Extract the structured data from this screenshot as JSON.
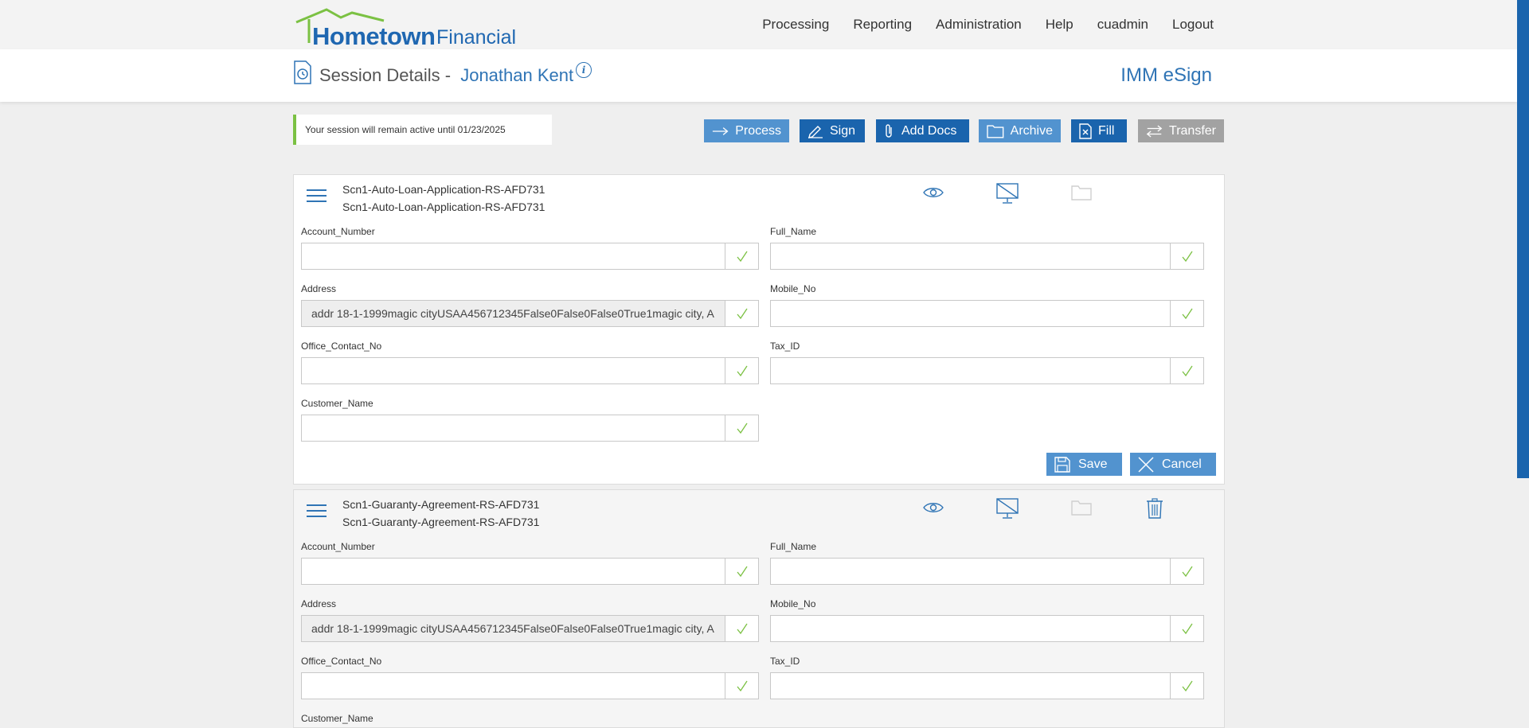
{
  "brand": {
    "name_primary": "Hometown",
    "name_secondary": "Financial"
  },
  "nav": {
    "items": [
      "Processing",
      "Reporting",
      "Administration",
      "Help",
      "cuadmin",
      "Logout"
    ]
  },
  "session": {
    "title": "Session Details -",
    "customer": "Jonathan Kent",
    "product": "IMM eSign"
  },
  "notice": "Your session will remain active until 01/23/2025",
  "actions": {
    "process": "Process",
    "sign": "Sign",
    "add_docs": "Add Docs",
    "archive": "Archive",
    "fill": "Fill",
    "transfer": "Transfer"
  },
  "documents": [
    {
      "title_line1": "Scn1-Auto-Loan-Application-RS-AFD731",
      "title_line2": "Scn1-Auto-Loan-Application-RS-AFD731",
      "fields": {
        "account_number": {
          "label": "Account_Number",
          "value": ""
        },
        "full_name": {
          "label": "Full_Name",
          "value": ""
        },
        "address": {
          "label": "Address",
          "value": "addr 18-1-1999magic cityUSAA456712345False0False0False0True1magic city, A"
        },
        "mobile_no": {
          "label": "Mobile_No",
          "value": ""
        },
        "office_contact_no": {
          "label": "Office_Contact_No",
          "value": ""
        },
        "tax_id": {
          "label": "Tax_ID",
          "value": ""
        },
        "customer_name": {
          "label": "Customer_Name",
          "value": ""
        }
      },
      "save_label": "Save",
      "cancel_label": "Cancel"
    },
    {
      "title_line1": "Scn1-Guaranty-Agreement-RS-AFD731",
      "title_line2": "Scn1-Guaranty-Agreement-RS-AFD731",
      "fields": {
        "account_number": {
          "label": "Account_Number",
          "value": ""
        },
        "full_name": {
          "label": "Full_Name",
          "value": ""
        },
        "address": {
          "label": "Address",
          "value": "addr 18-1-1999magic cityUSAA456712345False0False0False0True1magic city, A"
        },
        "mobile_no": {
          "label": "Mobile_No",
          "value": ""
        },
        "office_contact_no": {
          "label": "Office_Contact_No",
          "value": ""
        },
        "tax_id": {
          "label": "Tax_ID",
          "value": ""
        },
        "customer_name": {
          "label": "Customer_Name",
          "value": ""
        }
      }
    }
  ],
  "colors": {
    "brand_blue": "#1f67b1",
    "button_dark": "#1a64ad",
    "button_light": "#5293cf",
    "button_disabled": "#a2a2a2",
    "notice_accent": "#7bc143",
    "check_green": "#7bc143"
  }
}
